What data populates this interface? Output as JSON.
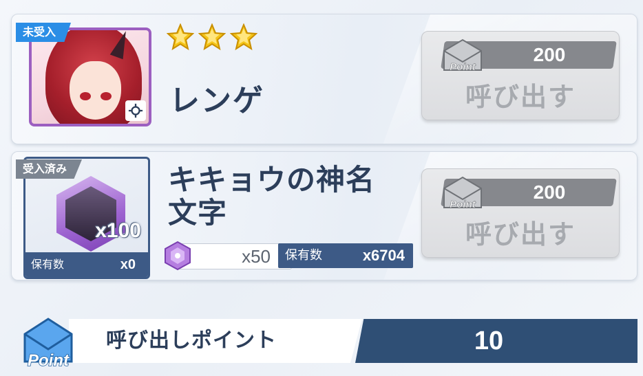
{
  "rows": [
    {
      "tag": "未受入",
      "tag_color": "#2b8ee6",
      "stars": 3,
      "name": "レンゲ",
      "cost_icon_text": "Point",
      "cost": "200",
      "button_label": "呼び出す"
    },
    {
      "tag": "受入済み",
      "tag_color": "#7c8591",
      "name": "キキョウの神名\n文字",
      "name_line1": "キキョウの神名",
      "name_line2": "文字",
      "item_count": "x100",
      "owned_label": "保有数",
      "owned_value": "x0",
      "material_cost": "x50",
      "material_owned_label": "保有数",
      "material_owned_value": "x6704",
      "cost_icon_text": "Point",
      "cost": "200",
      "button_label": "呼び出す"
    }
  ],
  "footer": {
    "icon_text": "Point",
    "label": "呼び出しポイント",
    "value": "10"
  },
  "colors": {
    "accent_blue": "#2b8ee6",
    "navy": "#2f4f75",
    "star": "#f5c518",
    "disabled_button": "#dcdde0"
  }
}
